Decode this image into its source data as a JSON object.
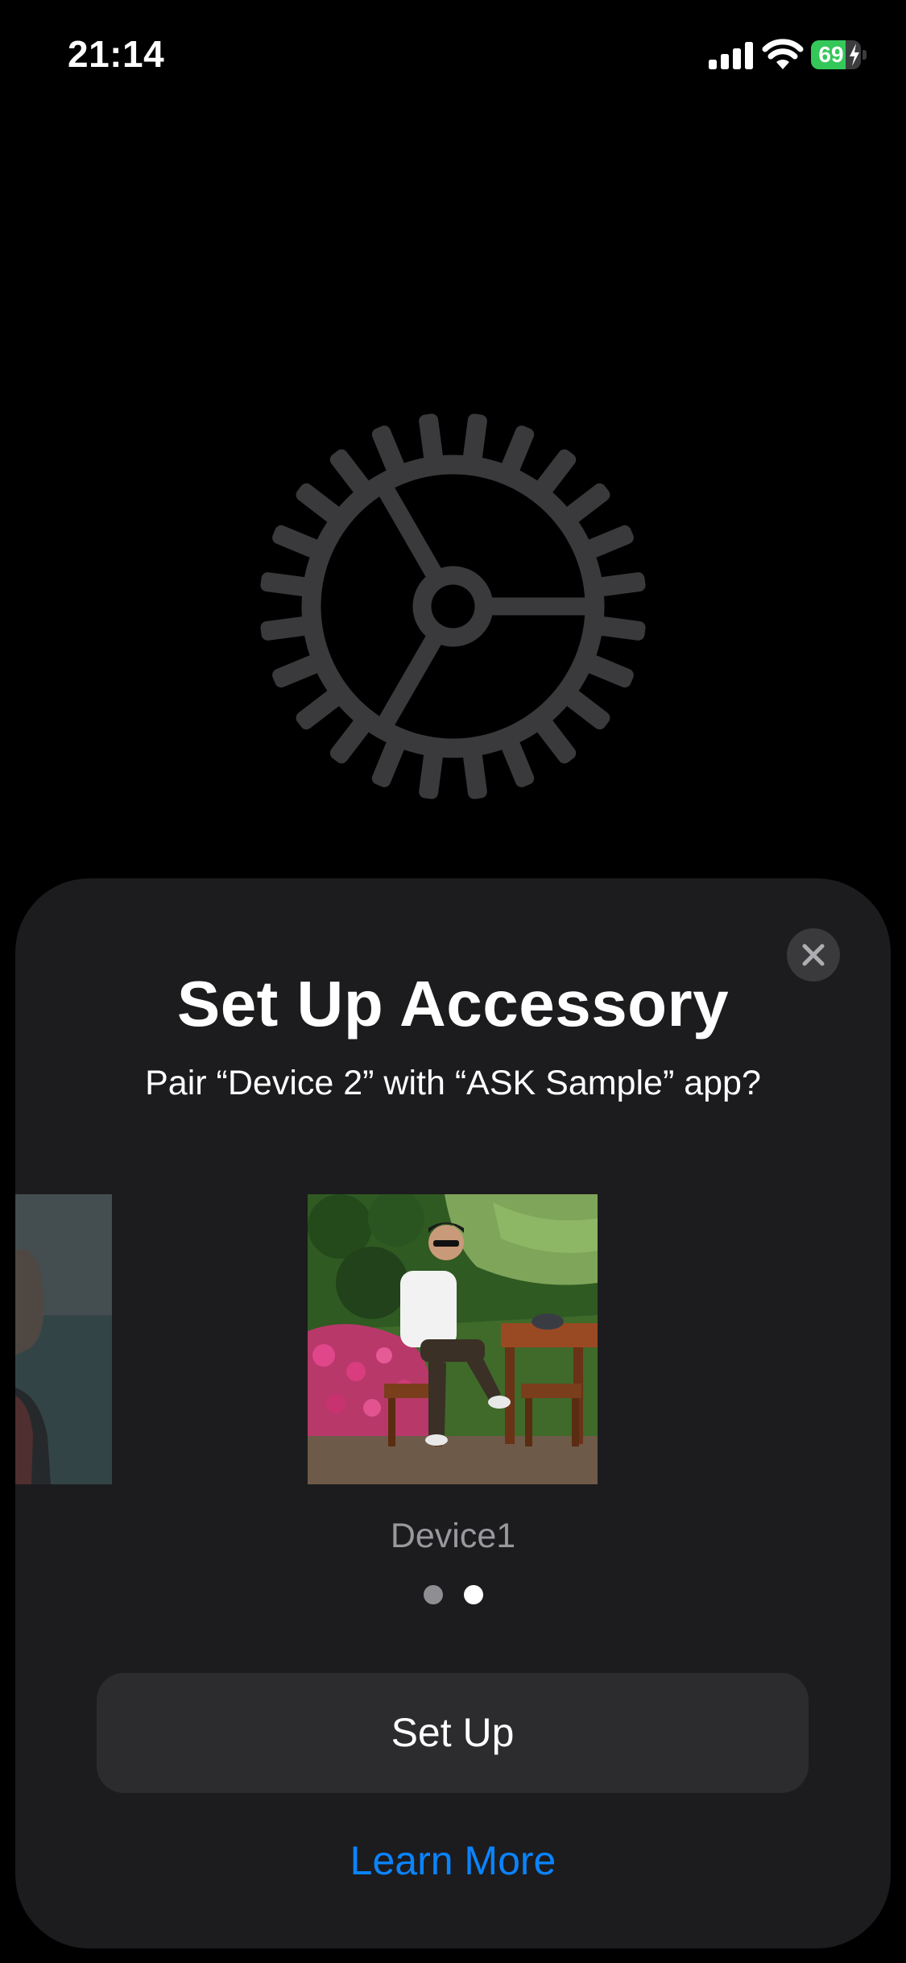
{
  "status_bar": {
    "time": "21:14",
    "battery_percent": "69",
    "battery_level": 0.69,
    "battery_color": "#34c759",
    "icons": [
      "signal-icon",
      "wifi-icon",
      "battery-icon",
      "charging-bolt-icon"
    ]
  },
  "background_icon": "gear-icon",
  "sheet": {
    "title": "Set Up Accessory",
    "subtitle": "Pair “Device 2” with “ASK Sample” app?",
    "close_icon": "close-icon",
    "carousel": {
      "current_device_name": "Device1",
      "page_count": 2,
      "active_page": 1
    },
    "setup_button_label": "Set Up",
    "learn_more_label": "Learn More",
    "accent_color": "#0a84ff"
  }
}
